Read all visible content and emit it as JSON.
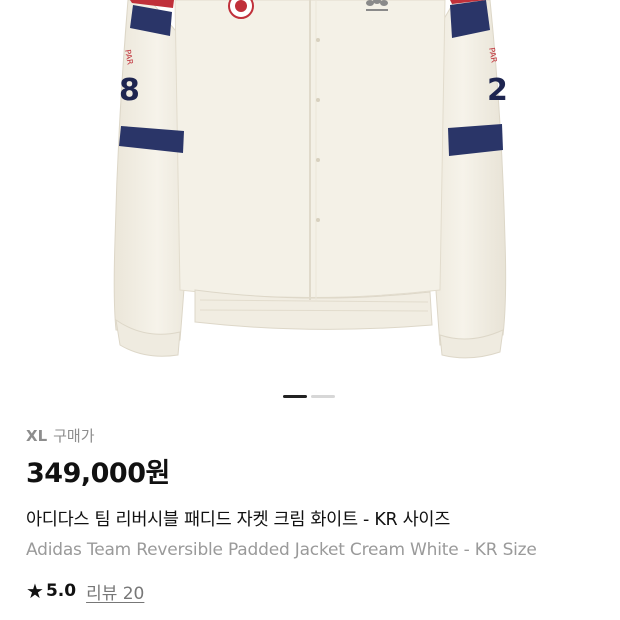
{
  "product": {
    "size": "XL",
    "purchase_label": "구매가",
    "price": "349,000원",
    "title_ko": "아디다스 팀 리버시블 패디드 자켓 크림 화이트 - KR 사이즈",
    "title_en": "Adidas Team Reversible Padded Jacket Cream White - KR Size",
    "rating": "5.0",
    "review_text": "리뷰 20"
  },
  "gallery": {
    "total_slides": 2,
    "active_slide": 1
  },
  "colors": {
    "jacket": "#f3efe4",
    "navy": "#2a3568",
    "red": "#c0303a"
  }
}
